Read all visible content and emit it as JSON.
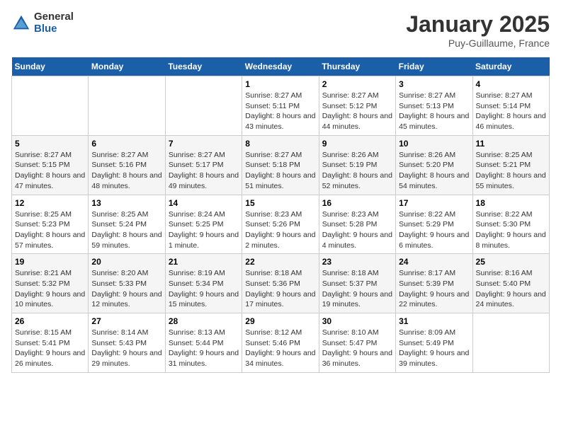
{
  "logo": {
    "general": "General",
    "blue": "Blue"
  },
  "title": "January 2025",
  "subtitle": "Puy-Guillaume, France",
  "weekdays": [
    "Sunday",
    "Monday",
    "Tuesday",
    "Wednesday",
    "Thursday",
    "Friday",
    "Saturday"
  ],
  "weeks": [
    [
      {
        "day": "",
        "sunrise": "",
        "sunset": "",
        "daylight": ""
      },
      {
        "day": "",
        "sunrise": "",
        "sunset": "",
        "daylight": ""
      },
      {
        "day": "",
        "sunrise": "",
        "sunset": "",
        "daylight": ""
      },
      {
        "day": "1",
        "sunrise": "Sunrise: 8:27 AM",
        "sunset": "Sunset: 5:11 PM",
        "daylight": "Daylight: 8 hours and 43 minutes."
      },
      {
        "day": "2",
        "sunrise": "Sunrise: 8:27 AM",
        "sunset": "Sunset: 5:12 PM",
        "daylight": "Daylight: 8 hours and 44 minutes."
      },
      {
        "day": "3",
        "sunrise": "Sunrise: 8:27 AM",
        "sunset": "Sunset: 5:13 PM",
        "daylight": "Daylight: 8 hours and 45 minutes."
      },
      {
        "day": "4",
        "sunrise": "Sunrise: 8:27 AM",
        "sunset": "Sunset: 5:14 PM",
        "daylight": "Daylight: 8 hours and 46 minutes."
      }
    ],
    [
      {
        "day": "5",
        "sunrise": "Sunrise: 8:27 AM",
        "sunset": "Sunset: 5:15 PM",
        "daylight": "Daylight: 8 hours and 47 minutes."
      },
      {
        "day": "6",
        "sunrise": "Sunrise: 8:27 AM",
        "sunset": "Sunset: 5:16 PM",
        "daylight": "Daylight: 8 hours and 48 minutes."
      },
      {
        "day": "7",
        "sunrise": "Sunrise: 8:27 AM",
        "sunset": "Sunset: 5:17 PM",
        "daylight": "Daylight: 8 hours and 49 minutes."
      },
      {
        "day": "8",
        "sunrise": "Sunrise: 8:27 AM",
        "sunset": "Sunset: 5:18 PM",
        "daylight": "Daylight: 8 hours and 51 minutes."
      },
      {
        "day": "9",
        "sunrise": "Sunrise: 8:26 AM",
        "sunset": "Sunset: 5:19 PM",
        "daylight": "Daylight: 8 hours and 52 minutes."
      },
      {
        "day": "10",
        "sunrise": "Sunrise: 8:26 AM",
        "sunset": "Sunset: 5:20 PM",
        "daylight": "Daylight: 8 hours and 54 minutes."
      },
      {
        "day": "11",
        "sunrise": "Sunrise: 8:25 AM",
        "sunset": "Sunset: 5:21 PM",
        "daylight": "Daylight: 8 hours and 55 minutes."
      }
    ],
    [
      {
        "day": "12",
        "sunrise": "Sunrise: 8:25 AM",
        "sunset": "Sunset: 5:23 PM",
        "daylight": "Daylight: 8 hours and 57 minutes."
      },
      {
        "day": "13",
        "sunrise": "Sunrise: 8:25 AM",
        "sunset": "Sunset: 5:24 PM",
        "daylight": "Daylight: 8 hours and 59 minutes."
      },
      {
        "day": "14",
        "sunrise": "Sunrise: 8:24 AM",
        "sunset": "Sunset: 5:25 PM",
        "daylight": "Daylight: 9 hours and 1 minute."
      },
      {
        "day": "15",
        "sunrise": "Sunrise: 8:23 AM",
        "sunset": "Sunset: 5:26 PM",
        "daylight": "Daylight: 9 hours and 2 minutes."
      },
      {
        "day": "16",
        "sunrise": "Sunrise: 8:23 AM",
        "sunset": "Sunset: 5:28 PM",
        "daylight": "Daylight: 9 hours and 4 minutes."
      },
      {
        "day": "17",
        "sunrise": "Sunrise: 8:22 AM",
        "sunset": "Sunset: 5:29 PM",
        "daylight": "Daylight: 9 hours and 6 minutes."
      },
      {
        "day": "18",
        "sunrise": "Sunrise: 8:22 AM",
        "sunset": "Sunset: 5:30 PM",
        "daylight": "Daylight: 9 hours and 8 minutes."
      }
    ],
    [
      {
        "day": "19",
        "sunrise": "Sunrise: 8:21 AM",
        "sunset": "Sunset: 5:32 PM",
        "daylight": "Daylight: 9 hours and 10 minutes."
      },
      {
        "day": "20",
        "sunrise": "Sunrise: 8:20 AM",
        "sunset": "Sunset: 5:33 PM",
        "daylight": "Daylight: 9 hours and 12 minutes."
      },
      {
        "day": "21",
        "sunrise": "Sunrise: 8:19 AM",
        "sunset": "Sunset: 5:34 PM",
        "daylight": "Daylight: 9 hours and 15 minutes."
      },
      {
        "day": "22",
        "sunrise": "Sunrise: 8:18 AM",
        "sunset": "Sunset: 5:36 PM",
        "daylight": "Daylight: 9 hours and 17 minutes."
      },
      {
        "day": "23",
        "sunrise": "Sunrise: 8:18 AM",
        "sunset": "Sunset: 5:37 PM",
        "daylight": "Daylight: 9 hours and 19 minutes."
      },
      {
        "day": "24",
        "sunrise": "Sunrise: 8:17 AM",
        "sunset": "Sunset: 5:39 PM",
        "daylight": "Daylight: 9 hours and 22 minutes."
      },
      {
        "day": "25",
        "sunrise": "Sunrise: 8:16 AM",
        "sunset": "Sunset: 5:40 PM",
        "daylight": "Daylight: 9 hours and 24 minutes."
      }
    ],
    [
      {
        "day": "26",
        "sunrise": "Sunrise: 8:15 AM",
        "sunset": "Sunset: 5:41 PM",
        "daylight": "Daylight: 9 hours and 26 minutes."
      },
      {
        "day": "27",
        "sunrise": "Sunrise: 8:14 AM",
        "sunset": "Sunset: 5:43 PM",
        "daylight": "Daylight: 9 hours and 29 minutes."
      },
      {
        "day": "28",
        "sunrise": "Sunrise: 8:13 AM",
        "sunset": "Sunset: 5:44 PM",
        "daylight": "Daylight: 9 hours and 31 minutes."
      },
      {
        "day": "29",
        "sunrise": "Sunrise: 8:12 AM",
        "sunset": "Sunset: 5:46 PM",
        "daylight": "Daylight: 9 hours and 34 minutes."
      },
      {
        "day": "30",
        "sunrise": "Sunrise: 8:10 AM",
        "sunset": "Sunset: 5:47 PM",
        "daylight": "Daylight: 9 hours and 36 minutes."
      },
      {
        "day": "31",
        "sunrise": "Sunrise: 8:09 AM",
        "sunset": "Sunset: 5:49 PM",
        "daylight": "Daylight: 9 hours and 39 minutes."
      },
      {
        "day": "",
        "sunrise": "",
        "sunset": "",
        "daylight": ""
      }
    ]
  ]
}
